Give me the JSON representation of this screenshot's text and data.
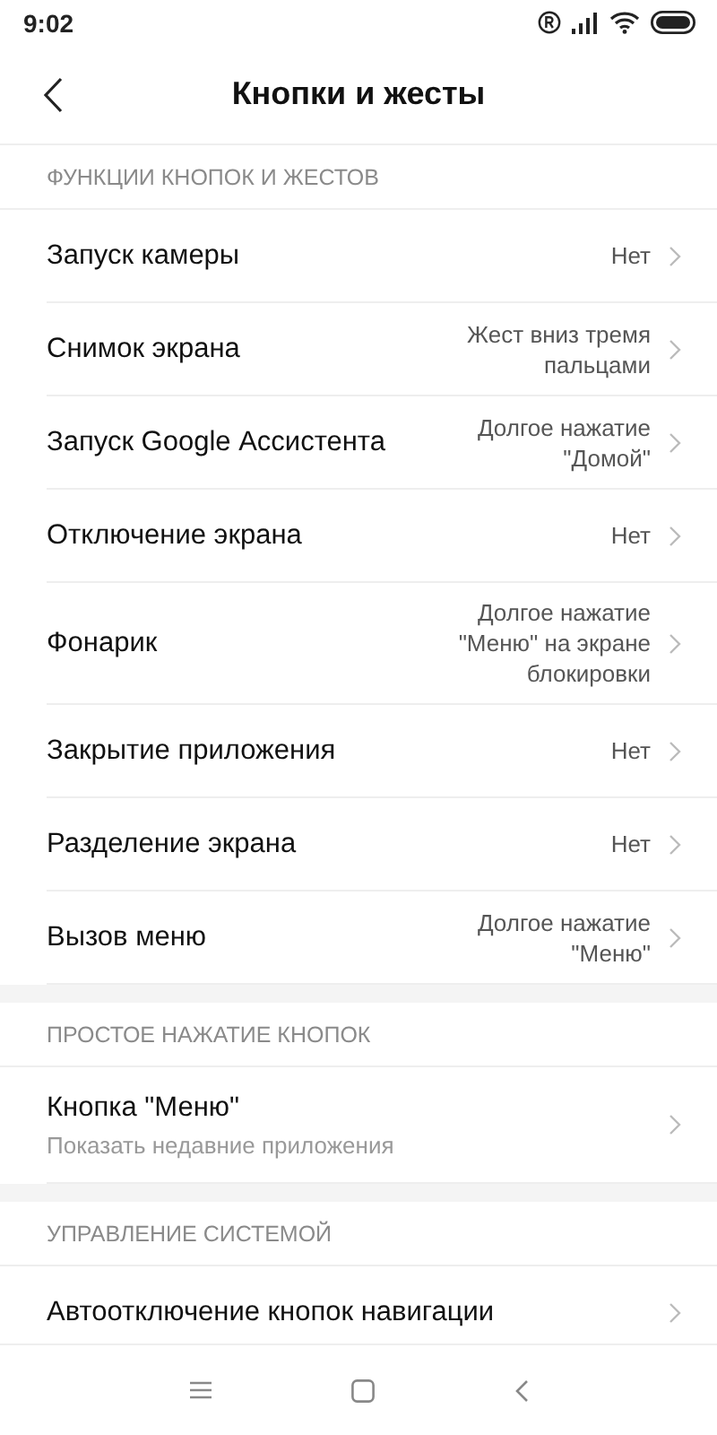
{
  "status_bar": {
    "time": "9:02"
  },
  "header": {
    "title": "Кнопки и жесты"
  },
  "sections": [
    {
      "title": "ФУНКЦИИ КНОПОК И ЖЕСТОВ",
      "items": [
        {
          "label": "Запуск камеры",
          "value": "Нет"
        },
        {
          "label": "Снимок экрана",
          "value": "Жест вниз тремя пальцами"
        },
        {
          "label": "Запуск Google Ассистента",
          "value": "Долгое нажатие \"Домой\""
        },
        {
          "label": "Отключение экрана",
          "value": "Нет"
        },
        {
          "label": "Фонарик",
          "value": "Долгое нажатие \"Меню\" на экране блокировки"
        },
        {
          "label": "Закрытие приложения",
          "value": "Нет"
        },
        {
          "label": "Разделение экрана",
          "value": "Нет"
        },
        {
          "label": "Вызов меню",
          "value": "Долгое нажатие \"Меню\""
        }
      ]
    },
    {
      "title": "ПРОСТОЕ НАЖАТИЕ КНОПОК",
      "items": [
        {
          "label": "Кнопка \"Меню\"",
          "subtitle": "Показать недавние приложения"
        }
      ]
    },
    {
      "title": "УПРАВЛЕНИЕ СИСТЕМОЙ",
      "items": [
        {
          "label": "Автоотключение кнопок навигации"
        }
      ]
    }
  ]
}
